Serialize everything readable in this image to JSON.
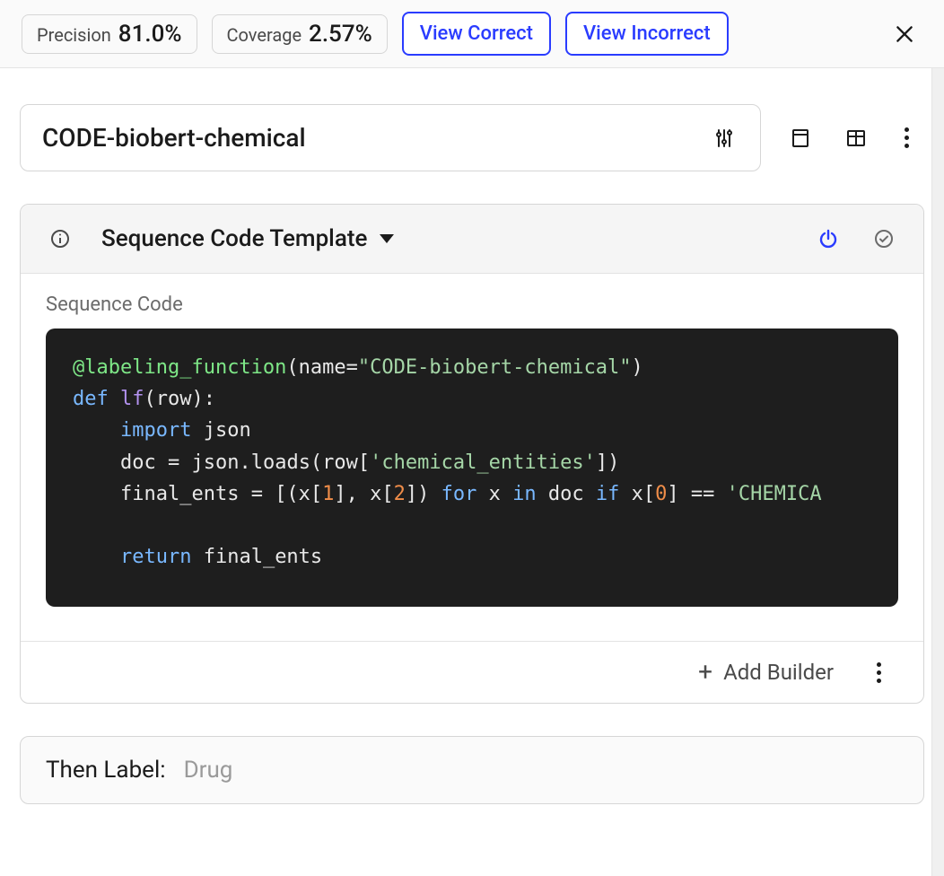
{
  "stats": {
    "precision_label": "Precision",
    "precision_value": "81.0%",
    "coverage_label": "Coverage",
    "coverage_value": "2.57%"
  },
  "actions": {
    "view_correct": "View Correct",
    "view_incorrect": "View Incorrect"
  },
  "lf": {
    "name": "CODE-biobert-chemical"
  },
  "builder": {
    "template_label": "Sequence Code Template",
    "section_label": "Sequence Code",
    "add_builder_label": "Add Builder"
  },
  "code": {
    "decorator_name": "labeling_function",
    "decorator_arg_key": "name",
    "decorator_arg_val": "\"CODE-biobert-chemical\"",
    "def": "def",
    "fn_name": "lf",
    "fn_arg": "row",
    "import_kw": "import",
    "import_mod": "json",
    "assign1_lhs": "doc",
    "assign1_rhs_a": "json.loads(row[",
    "assign1_rhs_key": "'chemical_entities'",
    "assign1_rhs_b": "])",
    "assign2_lhs": "final_ents",
    "assign2_open": "[(x[",
    "num1": "1",
    "assign2_mid": "], x[",
    "num2": "2",
    "assign2_close": "])",
    "for_kw": "for",
    "for_var": "x",
    "in_kw": "in",
    "for_iter": "doc",
    "if_kw": "if",
    "cond_lhs": "x[",
    "num0": "0",
    "cond_close": "]",
    "eqeq": "==",
    "cond_rhs": "'CHEMICA",
    "return_kw": "return",
    "return_val": "final_ents"
  },
  "label": {
    "key": "Then Label:",
    "value": "Drug"
  }
}
